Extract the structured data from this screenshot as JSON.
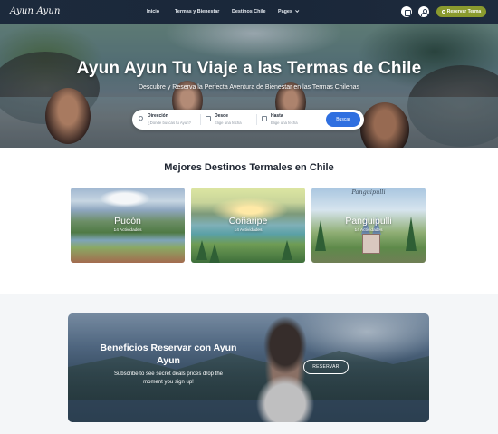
{
  "nav": {
    "logo": "Ayun Ayun",
    "links": [
      "Inicio",
      "Termas y Bienestar",
      "Destinos Chile",
      "Pages"
    ],
    "reserve_label": "Reservar Terma"
  },
  "hero": {
    "title": "Ayun Ayun Tu Viaje a las Termas de Chile",
    "subtitle": "Descubre y Reserva la Perfecta Aventura de Bienestar en las Termas Chilenas"
  },
  "search": {
    "direction_label": "Dirección",
    "direction_placeholder": "¿Dónde buscas tu Ayun?",
    "from_label": "Desde",
    "from_placeholder": "Elige una fecha",
    "to_label": "Hasta",
    "to_placeholder": "Elige una fecha",
    "button_label": "Buscar"
  },
  "destinations": {
    "title": "Mejores Destinos Termales en Chile",
    "cards": [
      {
        "name": "Pucón",
        "count": "14 Actividades"
      },
      {
        "name": "Coñaripe",
        "count": "14 Actividades"
      },
      {
        "name": "Panguipulli",
        "count": "14 Actividades",
        "script": "Panguipulli"
      }
    ]
  },
  "promo": {
    "title": "Beneficios Reservar con Ayun Ayun",
    "text": "Subscribe to see secret deals prices drop the moment you sign up!",
    "button_label": "RESERVAR"
  },
  "colors": {
    "nav_bg": "#1c2a3c",
    "accent_green": "#8a9a2e",
    "search_blue": "#2f6fe0"
  },
  "icons": [
    "calendar-icon",
    "user-icon",
    "search-icon",
    "location-pin-icon",
    "chevron-down-icon"
  ]
}
